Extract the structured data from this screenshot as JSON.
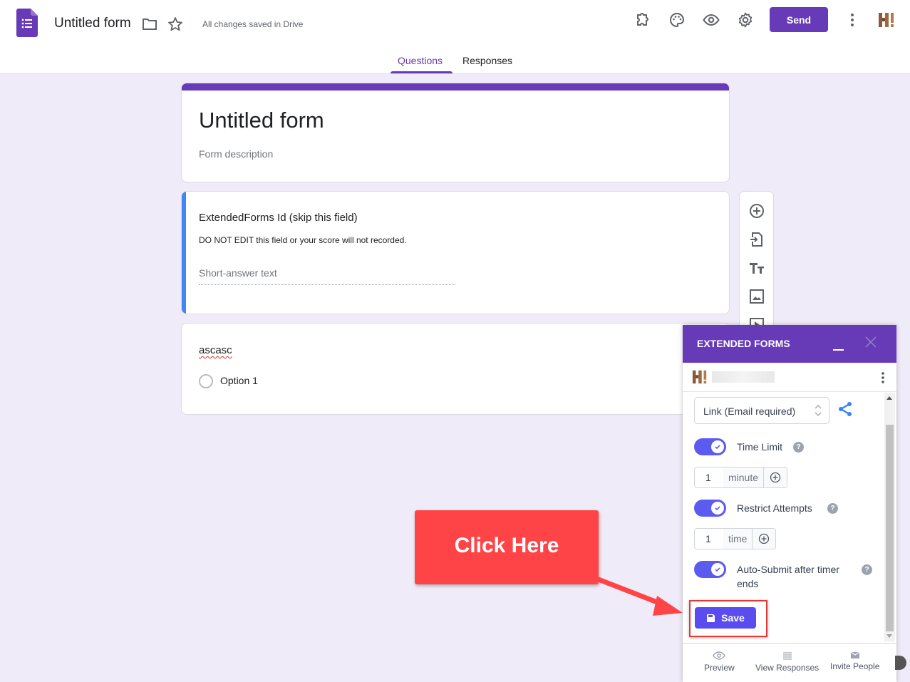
{
  "header": {
    "doc_title": "Untitled form",
    "save_status": "All changes saved in Drive",
    "send_label": "Send",
    "icons": [
      "forms-logo-icon",
      "folder-icon",
      "star-icon",
      "addons-puzzle-icon",
      "palette-icon",
      "preview-eye-icon",
      "settings-gear-icon",
      "more-vert-icon"
    ],
    "tabs": [
      {
        "label": "Questions",
        "active": true
      },
      {
        "label": "Responses",
        "active": false
      }
    ]
  },
  "form": {
    "title": "Untitled form",
    "description_placeholder": "Form description",
    "questions": [
      {
        "title": "ExtendedForms Id (skip this field)",
        "description": "DO NOT EDIT this field or your score will not recorded.",
        "answer_placeholder": "Short-answer text"
      },
      {
        "title": "ascasc",
        "options": [
          "Option 1"
        ]
      }
    ]
  },
  "side_toolbar": {
    "icons": [
      "add-question-icon",
      "import-questions-icon",
      "add-title-icon",
      "add-image-icon",
      "add-video-icon"
    ]
  },
  "extended_forms": {
    "title": "EXTENDED FORMS",
    "share_mode": "Link (Email required)",
    "settings": [
      {
        "label": "Time Limit",
        "enabled": true,
        "value": "1",
        "unit": "minute"
      },
      {
        "label": "Restrict Attempts",
        "enabled": true,
        "value": "1",
        "unit": "time"
      },
      {
        "label": "Auto-Submit after timer ends",
        "enabled": true
      }
    ],
    "save_label": "Save",
    "footer": [
      {
        "label": "Preview",
        "icon": "eye-icon"
      },
      {
        "label": "View Responses",
        "icon": "list-icon"
      },
      {
        "label": "Invite People",
        "icon": "envelope-icon"
      }
    ]
  },
  "annotation": {
    "callout_text": "Click Here",
    "color": "#ff4447"
  },
  "colors": {
    "brand": "#673ab7",
    "accent_blue": "#4285f4",
    "toggle": "#5b5bf0",
    "background": "#f0ebf8"
  }
}
